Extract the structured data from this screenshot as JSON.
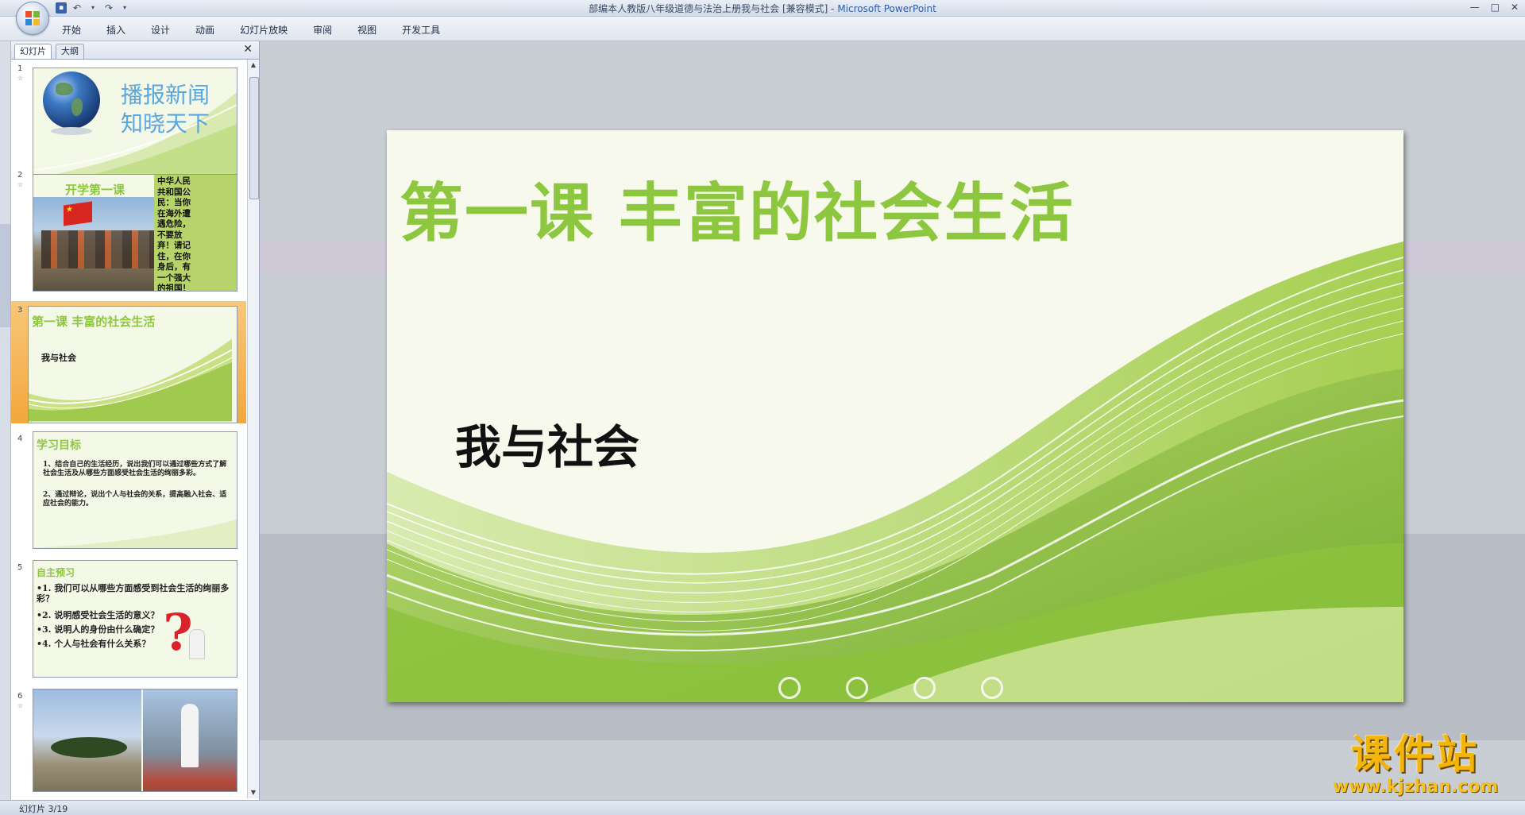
{
  "window": {
    "title": "部编本人教版八年级道德与法治上册我与社会 [兼容模式]",
    "app_name": "Microsoft PowerPoint",
    "controls": [
      "—",
      "□",
      "✕"
    ]
  },
  "quick_access": [
    "save-icon",
    "undo-icon",
    "redo-icon",
    "customize-icon"
  ],
  "ribbon": {
    "tabs": [
      "开始",
      "插入",
      "设计",
      "动画",
      "幻灯片放映",
      "审阅",
      "视图",
      "开发工具"
    ]
  },
  "panel": {
    "tabs": [
      "幻灯片",
      "大纲"
    ],
    "close": "✕"
  },
  "thumbnails": [
    {
      "number": "1",
      "title_line1": "播报新闻",
      "title_line2": "知晓天下"
    },
    {
      "number": "2",
      "title": "开学第一课",
      "side_text": "中华人民共和国公民：当你在海外遭遇危险，不要放弃！请记住，在你身后，有一个强大的祖国！"
    },
    {
      "number": "3",
      "title": "第一课  丰富的社会生活",
      "subtitle": "我与社会",
      "selected": true
    },
    {
      "number": "4",
      "title": "学习目标",
      "lines": [
        "1、结合自己的生活经历，说出我们可以通过哪些方式了解社会生活及从哪些方面感受社会生活的绚丽多彩。",
        "2、通过辩论，说出个人与社会的关系，提高融入社会、适应社会的能力。"
      ]
    },
    {
      "number": "5",
      "title": "自主预习",
      "lines": [
        "•1. 我们可以从哪些方面感受到社会生活的绚丽多彩？",
        "•2. 说明感受社会生活的意义？",
        "•3. 说明人的身份由什么确定？",
        "•4. 个人与社会有什么关系？"
      ]
    },
    {
      "number": "6"
    }
  ],
  "slide": {
    "title": "第一课  丰富的社会生活",
    "subtitle": "我与社会",
    "dots": 4
  },
  "status": {
    "text": "幻灯片 3/19"
  },
  "watermark": {
    "cn": "课件站",
    "url": "www.kjzhan.com"
  },
  "colors": {
    "accent_green": "#8dc63f",
    "selection_orange": "#f3a73d",
    "watermark_gold": "#f3b50b"
  }
}
